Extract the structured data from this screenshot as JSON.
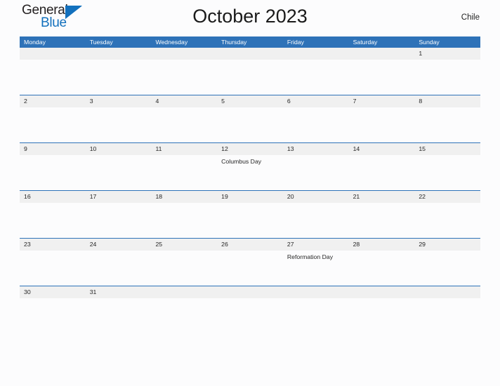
{
  "brand": {
    "name_part1": "General",
    "name_part2": "Blue",
    "flag_icon": "pennant-flag-icon",
    "color_dark": "#231f20",
    "color_blue": "#1270bd"
  },
  "header": {
    "title": "October 2023",
    "country": "Chile"
  },
  "theme": {
    "header_blue": "#2e72b8",
    "band_gray": "#f0f0f0",
    "page_background": "#fcfcfd",
    "text_color": "#262626"
  },
  "calendar": {
    "weekdays": [
      "Monday",
      "Tuesday",
      "Wednesday",
      "Thursday",
      "Friday",
      "Saturday",
      "Sunday"
    ],
    "weeks": [
      {
        "days": [
          {
            "date": "",
            "event": ""
          },
          {
            "date": "",
            "event": ""
          },
          {
            "date": "",
            "event": ""
          },
          {
            "date": "",
            "event": ""
          },
          {
            "date": "",
            "event": ""
          },
          {
            "date": "",
            "event": ""
          },
          {
            "date": "1",
            "event": ""
          }
        ]
      },
      {
        "days": [
          {
            "date": "2",
            "event": ""
          },
          {
            "date": "3",
            "event": ""
          },
          {
            "date": "4",
            "event": ""
          },
          {
            "date": "5",
            "event": ""
          },
          {
            "date": "6",
            "event": ""
          },
          {
            "date": "7",
            "event": ""
          },
          {
            "date": "8",
            "event": ""
          }
        ]
      },
      {
        "days": [
          {
            "date": "9",
            "event": ""
          },
          {
            "date": "10",
            "event": ""
          },
          {
            "date": "11",
            "event": ""
          },
          {
            "date": "12",
            "event": "Columbus Day"
          },
          {
            "date": "13",
            "event": ""
          },
          {
            "date": "14",
            "event": ""
          },
          {
            "date": "15",
            "event": ""
          }
        ]
      },
      {
        "days": [
          {
            "date": "16",
            "event": ""
          },
          {
            "date": "17",
            "event": ""
          },
          {
            "date": "18",
            "event": ""
          },
          {
            "date": "19",
            "event": ""
          },
          {
            "date": "20",
            "event": ""
          },
          {
            "date": "21",
            "event": ""
          },
          {
            "date": "22",
            "event": ""
          }
        ]
      },
      {
        "days": [
          {
            "date": "23",
            "event": ""
          },
          {
            "date": "24",
            "event": ""
          },
          {
            "date": "25",
            "event": ""
          },
          {
            "date": "26",
            "event": ""
          },
          {
            "date": "27",
            "event": "Reformation Day"
          },
          {
            "date": "28",
            "event": ""
          },
          {
            "date": "29",
            "event": ""
          }
        ]
      },
      {
        "days": [
          {
            "date": "30",
            "event": ""
          },
          {
            "date": "31",
            "event": ""
          },
          {
            "date": "",
            "event": ""
          },
          {
            "date": "",
            "event": ""
          },
          {
            "date": "",
            "event": ""
          },
          {
            "date": "",
            "event": ""
          },
          {
            "date": "",
            "event": ""
          }
        ]
      }
    ]
  }
}
